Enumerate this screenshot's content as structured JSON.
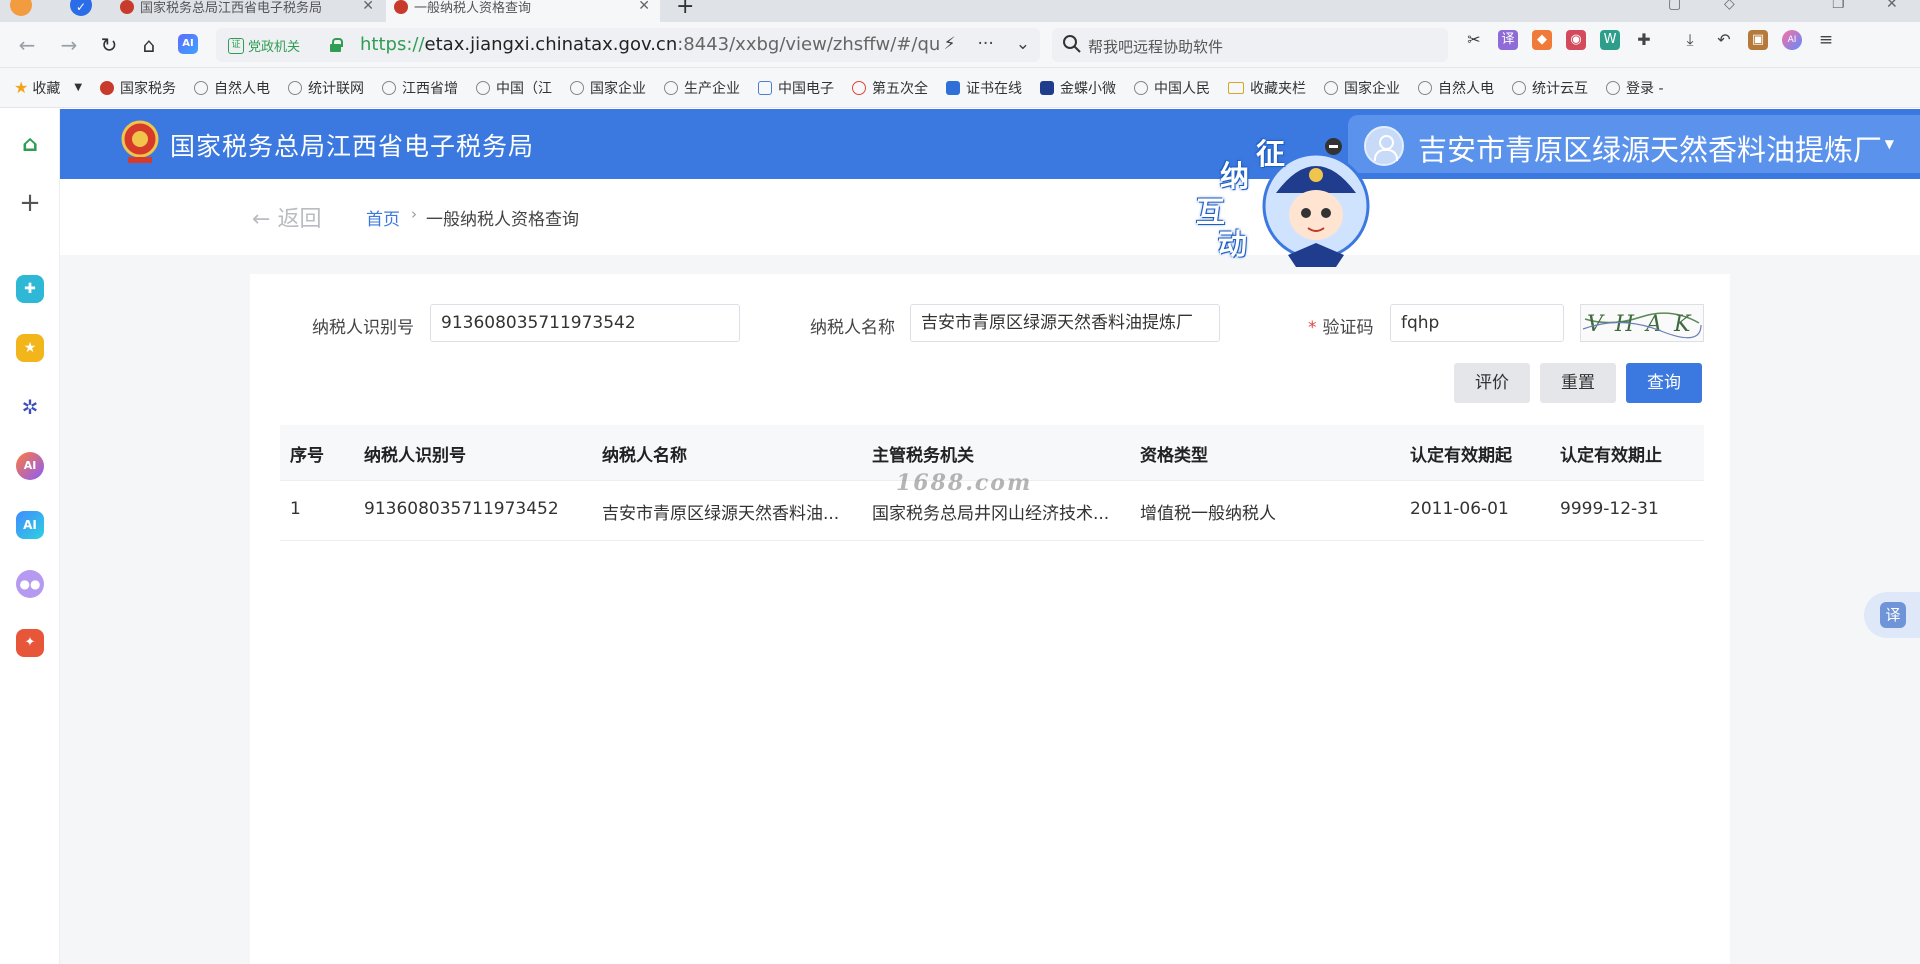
{
  "browser": {
    "tabs": [
      {
        "label": "国家税务总局江西省电子税务局"
      },
      {
        "label": "一般纳税人资格查询"
      }
    ],
    "address": {
      "gov_badge": "党政机关",
      "scheme": "https://",
      "host": "etax.jiangxi.chinatax.gov.cn",
      "rest": ":8443/xxbg/view/zhsffw/#/query"
    },
    "search_placeholder": "帮我吧远程协助软件",
    "bookmarks": [
      {
        "label": "收藏",
        "icon": "star-icon"
      },
      {
        "label": "国家税务",
        "icon": "emblem-icon"
      },
      {
        "label": "自然人电",
        "icon": "globe-icon"
      },
      {
        "label": "统计联网",
        "icon": "globe-icon"
      },
      {
        "label": "江西省增",
        "icon": "globe-icon"
      },
      {
        "label": "中国（江",
        "icon": "globe-icon"
      },
      {
        "label": "国家企业",
        "icon": "globe-icon"
      },
      {
        "label": "生产企业",
        "icon": "globe-icon"
      },
      {
        "label": "中国电子",
        "icon": "shield-icon"
      },
      {
        "label": "第五次全",
        "icon": "c-icon"
      },
      {
        "label": "证书在线",
        "icon": "cert-icon"
      },
      {
        "label": "金蝶小微",
        "icon": "k-icon"
      },
      {
        "label": "中国人民",
        "icon": "globe-icon"
      },
      {
        "label": "收藏夹栏",
        "icon": "folder-icon"
      },
      {
        "label": "国家企业",
        "icon": "globe-icon"
      },
      {
        "label": "自然人电",
        "icon": "globe-icon"
      },
      {
        "label": "统计云互",
        "icon": "globe-icon"
      },
      {
        "label": "登录 -",
        "icon": "globe-icon"
      }
    ]
  },
  "header": {
    "site_title": "国家税务总局江西省电子税务局",
    "user_name": "吉安市青原区绿源天然香料油提炼厂",
    "mascot_chars": [
      "征",
      "纳",
      "互",
      "动"
    ]
  },
  "breadcrumb": {
    "back_label": "返回",
    "home": "首页",
    "separator": "›",
    "current": "一般纳税人资格查询"
  },
  "form": {
    "taxpayer_id_label": "纳税人识别号",
    "taxpayer_id_value": "913608035711973542",
    "taxpayer_name_label": "纳税人名称",
    "taxpayer_name_value": "吉安市青原区绿源天然香料油提炼厂",
    "captcha_required": "*",
    "captcha_label": "验证码",
    "captcha_value": "fqhp",
    "captcha_image_text": "VHAK",
    "buttons": {
      "evaluate": "评价",
      "reset": "重置",
      "query": "查询"
    }
  },
  "table": {
    "headers": [
      "序号",
      "纳税人识别号",
      "纳税人名称",
      "主管税务机关",
      "资格类型",
      "认定有效期起",
      "认定有效期止"
    ],
    "rows": [
      [
        "1",
        "913608035711973452",
        "吉安市青原区绿源天然香料油...",
        "国家税务总局井冈山经济技术...",
        "增值税一般纳税人",
        "2011-06-01",
        "9999-12-31"
      ]
    ]
  },
  "watermark": "1688.com",
  "translate_fab": "译",
  "colors": {
    "brand": "#3b79e0",
    "accent_green": "#2f9e52",
    "required": "#e0463e"
  }
}
